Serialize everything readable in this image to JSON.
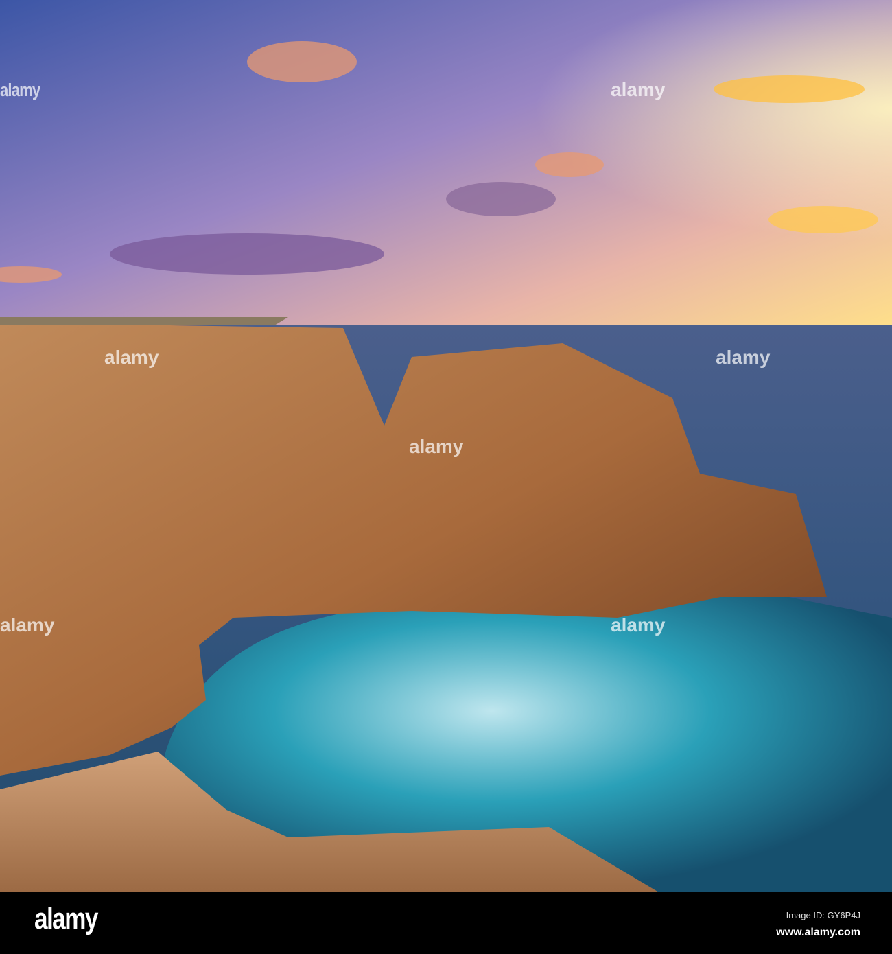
{
  "photo": {
    "watermark_text": "alamy",
    "colors": {
      "sky_top": "#4a5fa8",
      "sky_mid": "#b88ab8",
      "horizon": "#ffd890",
      "sea": "#3d5f8e",
      "surf": "#2a9db5",
      "rock": "#b87a48"
    }
  },
  "footer": {
    "logo": "alamy",
    "image_id": "Image ID: GY6P4J",
    "website": "www.alamy.com"
  }
}
